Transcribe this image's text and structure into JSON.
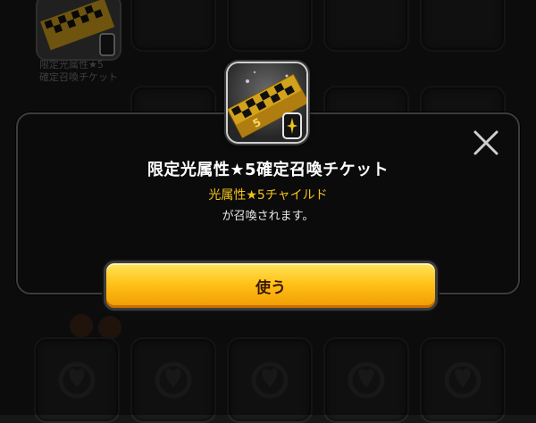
{
  "background": {
    "item_label": "限定光属性★5確定召喚チケット",
    "item_label_visible": "限定光属性★5\n確定召喚チケット"
  },
  "dialog": {
    "title": "限定光属性★5確定召喚チケット",
    "highlight": "光属性★5チャイルド",
    "description": "が召喚されます。",
    "use_button_label": "使う",
    "close_icon": "close-icon",
    "item_icon": "summon-ticket-icon",
    "badge_icon": "light-attribute-icon"
  },
  "colors": {
    "accent": "#f2c21a",
    "button_top": "#ffe45a",
    "button_bottom": "#f19a00",
    "modal_bg": "#0b0b0b"
  }
}
